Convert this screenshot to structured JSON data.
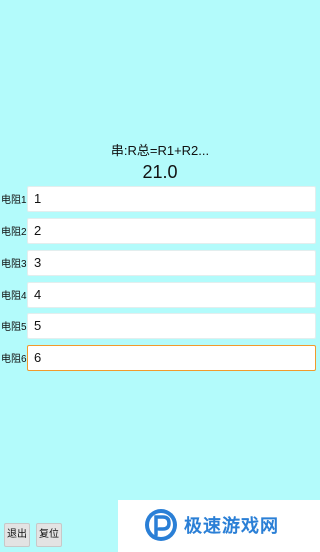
{
  "formula": "串:R总=R1+R2...",
  "result": "21.0",
  "resistors": [
    {
      "label": "电阻1:",
      "value": "1"
    },
    {
      "label": "电阻2:",
      "value": "2"
    },
    {
      "label": "电阻3:",
      "value": "3"
    },
    {
      "label": "电阻4:",
      "value": "4"
    },
    {
      "label": "电阻5:",
      "value": "5"
    },
    {
      "label": "电阻6:",
      "value": "6"
    }
  ],
  "buttons": {
    "exit_label": "退出",
    "reset_label": "复位"
  },
  "watermark": {
    "text": "极速游戏网",
    "logo_icon": "p-logo-icon"
  },
  "colors": {
    "background": "#b3fbfb",
    "focus_border": "#f19a2c",
    "watermark_text": "#2a7fd6"
  }
}
